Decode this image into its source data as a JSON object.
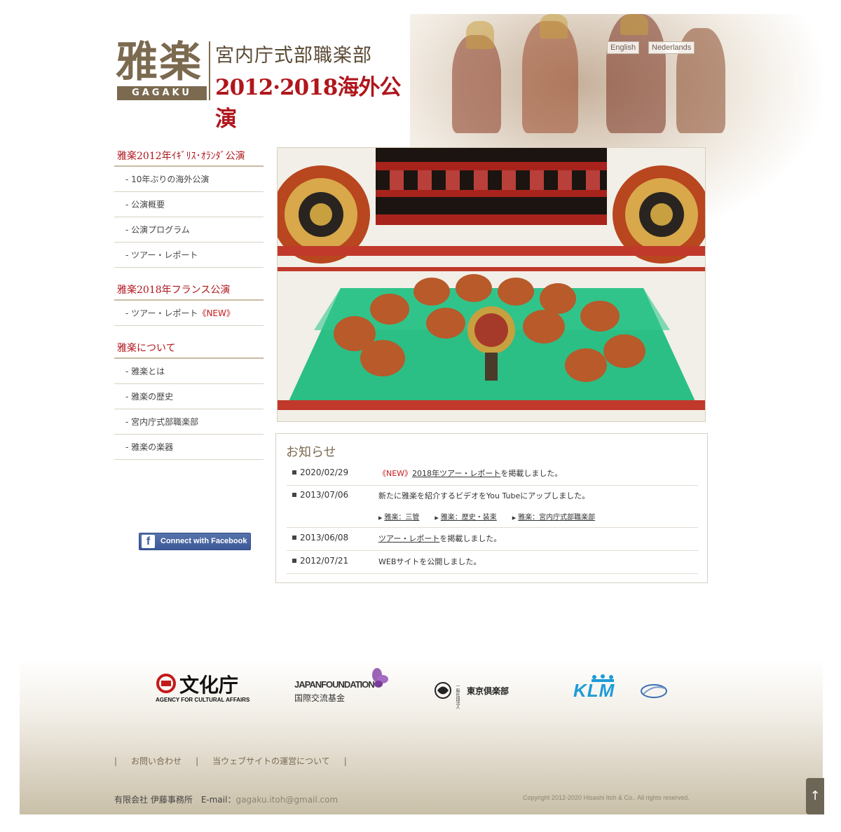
{
  "header": {
    "logo_kanji": "雅楽",
    "logo_romaji": "GAGAKU",
    "logo_line1": "宮内庁式部職楽部",
    "logo_line2": "2012·2018海外公演",
    "lang_en": "English",
    "lang_nl": "Nederlands"
  },
  "sidebar": {
    "section1": {
      "title": "雅楽2012年ｲｷﾞﾘｽ･ｵﾗﾝﾀﾞ公演",
      "items": [
        "- 10年ぶりの海外公演",
        "- 公演概要",
        "- 公演プログラム",
        "- ツアー・レポート"
      ]
    },
    "section2": {
      "title": "雅楽2018年フランス公演",
      "item": "- ツアー・レポート",
      "new_badge": "《NEW》"
    },
    "section3": {
      "title": "雅楽について",
      "items": [
        "- 雅楽とは",
        "- 雅楽の歴史",
        "- 宮内庁式部職楽部",
        "- 雅楽の楽器"
      ]
    },
    "facebook_label": "Connect with Facebook",
    "facebook_icon": "f"
  },
  "news": {
    "title": "お知らせ",
    "items": [
      {
        "date": "2020/02/29",
        "new_badge": "《NEW》",
        "link": "2018年ツアー・レポート",
        "text": "を掲載しました。"
      },
      {
        "date": "2013/07/06",
        "text": "新たに雅楽を紹介するビデオをYou Tubeにアップしました。",
        "sublinks": [
          "雅楽：三管",
          "雅楽：歴史・装束",
          "雅楽：宮内庁式部職楽部"
        ]
      },
      {
        "date": "2013/06/08",
        "link": "ツアー・レポート",
        "text": "を掲載しました。"
      },
      {
        "date": "2012/07/21",
        "text": "WEBサイトを公開しました。"
      }
    ]
  },
  "sponsors": {
    "bunka_name": "文化庁",
    "bunka_sub": "AGENCY FOR CULTURAL AFFAIRS",
    "jf_name": "JAPANFOUNDATION",
    "jf_sub": "国際交流基金",
    "tokyo_kurabu": "東京倶楽部",
    "tokyo_kurabu_prefix": "一般社団法人",
    "klm": "KLM"
  },
  "footer": {
    "sep": "|",
    "link1": "お問い合わせ",
    "link2": "当ウェブサイトの運営について",
    "company": "有限会社 伊藤事務所　E-mail：",
    "email": "gagaku.itoh@gmail.com",
    "copyright": "Copyright 2012-2020 Hisashi Itoh & Co.. All rights reserved.",
    "to_top": "↑"
  },
  "colors": {
    "accent_red": "#b0161c",
    "brand_brown": "#7b6a4f",
    "facebook_blue": "#3b5998"
  }
}
